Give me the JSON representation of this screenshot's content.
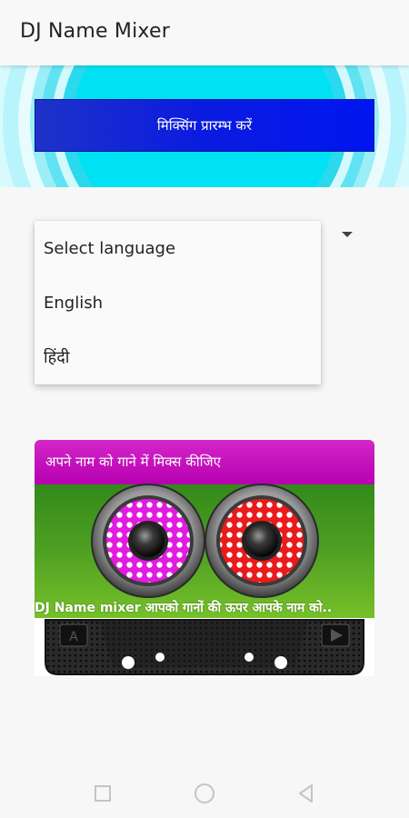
{
  "appbar": {
    "title": "DJ Name Mixer"
  },
  "hero": {
    "start_button_label": "मिक्सिंग प्रारम्भ करें"
  },
  "language_menu": {
    "items": [
      "Select language",
      "English",
      "हिंदी"
    ]
  },
  "promo_card": {
    "header": "अपने नाम को गाने में मिक्स कीजिए",
    "marquee": "DJ Name mixer आपको गानों की ऊपर आपके नाम को.."
  },
  "navigation": {
    "buttons": [
      "recents-icon",
      "home-icon",
      "back-icon"
    ]
  },
  "colors": {
    "accent_blue": "#0a1be0",
    "magenta": "#c014b8",
    "green": "#4d9e22",
    "cyan": "#00e5f0"
  }
}
